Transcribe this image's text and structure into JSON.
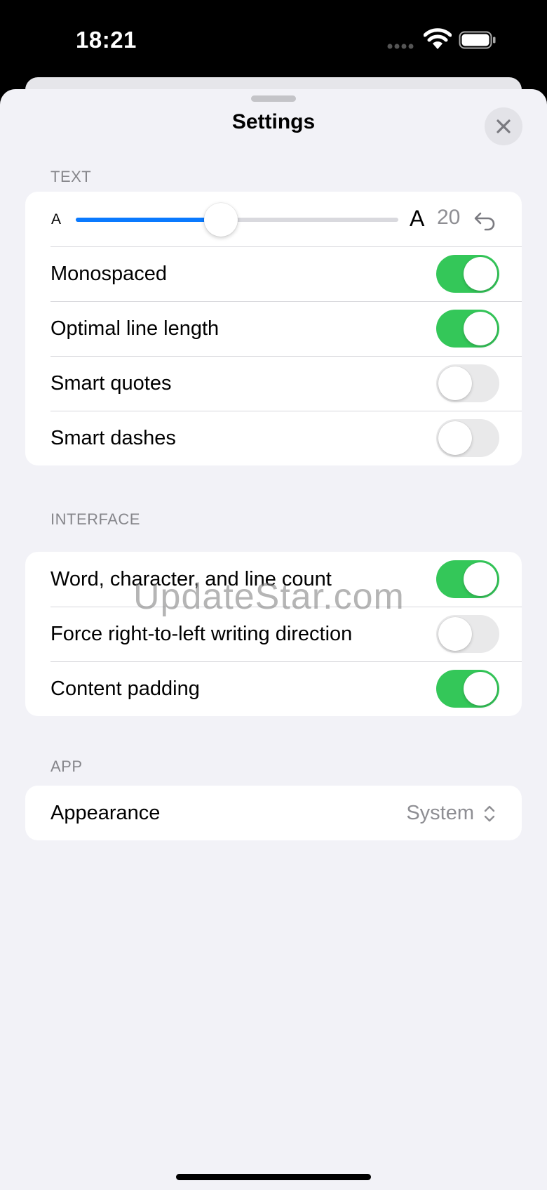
{
  "status_bar": {
    "time": "18:21"
  },
  "sheet": {
    "title": "Settings"
  },
  "sections": {
    "text": {
      "header": "TEXT",
      "font_size": {
        "small_glyph": "A",
        "large_glyph": "A",
        "value": "20",
        "fraction": 0.45
      },
      "rows": [
        {
          "label": "Monospaced",
          "on": true
        },
        {
          "label": "Optimal line length",
          "on": true
        },
        {
          "label": "Smart quotes",
          "on": false
        },
        {
          "label": "Smart dashes",
          "on": false
        }
      ]
    },
    "interface": {
      "header": "INTERFACE",
      "rows": [
        {
          "label": "Word, character, and line count",
          "on": true
        },
        {
          "label": "Force right-to-left writing direction",
          "on": false
        },
        {
          "label": "Content padding",
          "on": true
        }
      ]
    },
    "app": {
      "header": "APP",
      "appearance": {
        "label": "Appearance",
        "value": "System"
      }
    }
  },
  "watermark": "UpdateStar.com",
  "colors": {
    "accent": "#0a7aff",
    "toggle_on": "#34c759",
    "toggle_off": "#e9e9ea"
  }
}
